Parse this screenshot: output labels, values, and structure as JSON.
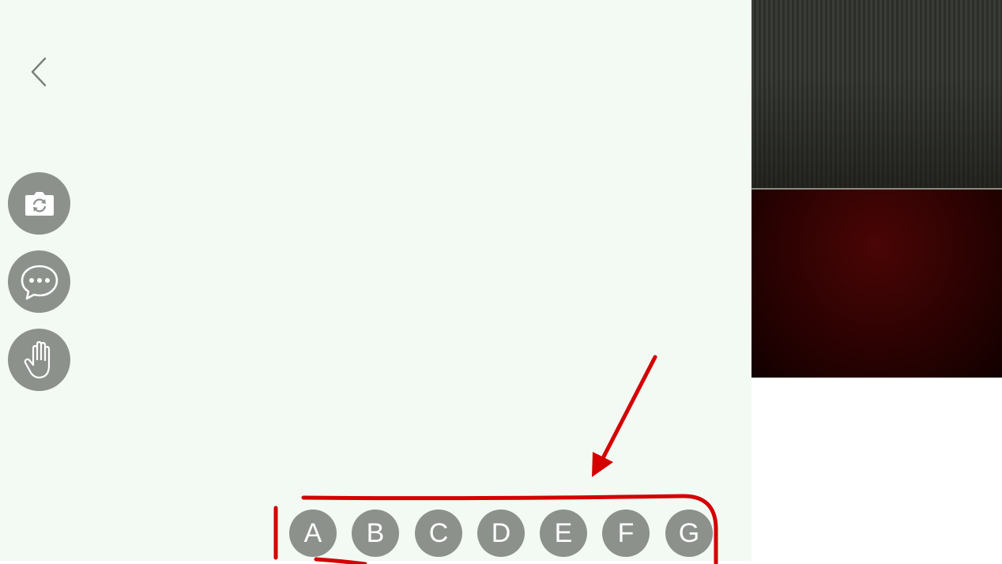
{
  "toolbar": {
    "back_icon": "chevron-left-icon",
    "buttons": [
      {
        "id": "camera",
        "icon": "camera-switch-icon"
      },
      {
        "id": "chat",
        "icon": "chat-bubble-icon"
      },
      {
        "id": "hand",
        "icon": "raise-hand-icon"
      }
    ]
  },
  "answer_options": [
    "A",
    "B",
    "C",
    "D",
    "E",
    "F",
    "G"
  ],
  "colors": {
    "main_background": "#f3f9f3",
    "button_fill": "#8c918c",
    "annotation": "#d40000"
  },
  "video_tiles": [
    {
      "id": "tile-1",
      "description_color": "#33352f"
    },
    {
      "id": "tile-2",
      "description_color": "#2c0202"
    }
  ]
}
